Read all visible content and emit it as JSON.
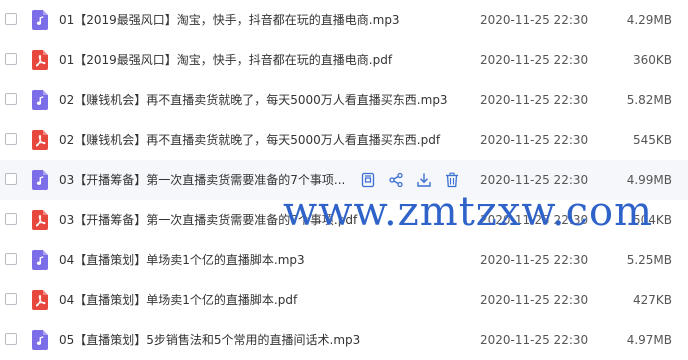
{
  "colors": {
    "audio_icon": "#7b6ee8",
    "pdf_icon": "#e8473e",
    "hover_bg": "#f5f7fb",
    "action_icon": "#3b6fd1",
    "watermark": "#2f63c9"
  },
  "files": [
    {
      "name": "01【2019最强风口】淘宝，快手，抖音都在玩的直播电商.mp3",
      "type": "audio",
      "date": "2020-11-25 22:30",
      "size": "4.29MB"
    },
    {
      "name": "01【2019最强风口】淘宝，快手，抖音都在玩的直播电商.pdf",
      "type": "pdf",
      "date": "2020-11-25 22:30",
      "size": "360KB"
    },
    {
      "name": "02【赚钱机会】再不直播卖货就晚了，每天5000万人看直播买东西.mp3",
      "type": "audio",
      "date": "2020-11-25 22:30",
      "size": "5.82MB"
    },
    {
      "name": "02【赚钱机会】再不直播卖货就晚了，每天5000万人看直播买东西.pdf",
      "type": "pdf",
      "date": "2020-11-25 22:30",
      "size": "545KB"
    },
    {
      "name": "03【开播筹备】第一次直播卖货需要准备的7个事项...",
      "type": "audio",
      "date": "2020-11-25 22:30",
      "size": "4.99MB",
      "hover": true
    },
    {
      "name": "03【开播筹备】第一次直播卖货需要准备的7个事项.pdf",
      "type": "pdf",
      "date": "2020-11-25 22:30",
      "size": "504KB"
    },
    {
      "name": "04【直播策划】单场卖1个亿的直播脚本.mp3",
      "type": "audio",
      "date": "2020-11-25 22:30",
      "size": "5.25MB"
    },
    {
      "name": "04【直播策划】单场卖1个亿的直播脚本.pdf",
      "type": "pdf",
      "date": "2020-11-25 22:30",
      "size": "427KB"
    },
    {
      "name": "05【直播策划】5步销售法和5个常用的直播间话术.mp3",
      "type": "audio",
      "date": "2020-11-25 22:30",
      "size": "4.97MB"
    }
  ],
  "row_actions": [
    "open-icon",
    "share-icon",
    "download-icon",
    "delete-icon"
  ],
  "watermark": "www.zmtzxw.com"
}
